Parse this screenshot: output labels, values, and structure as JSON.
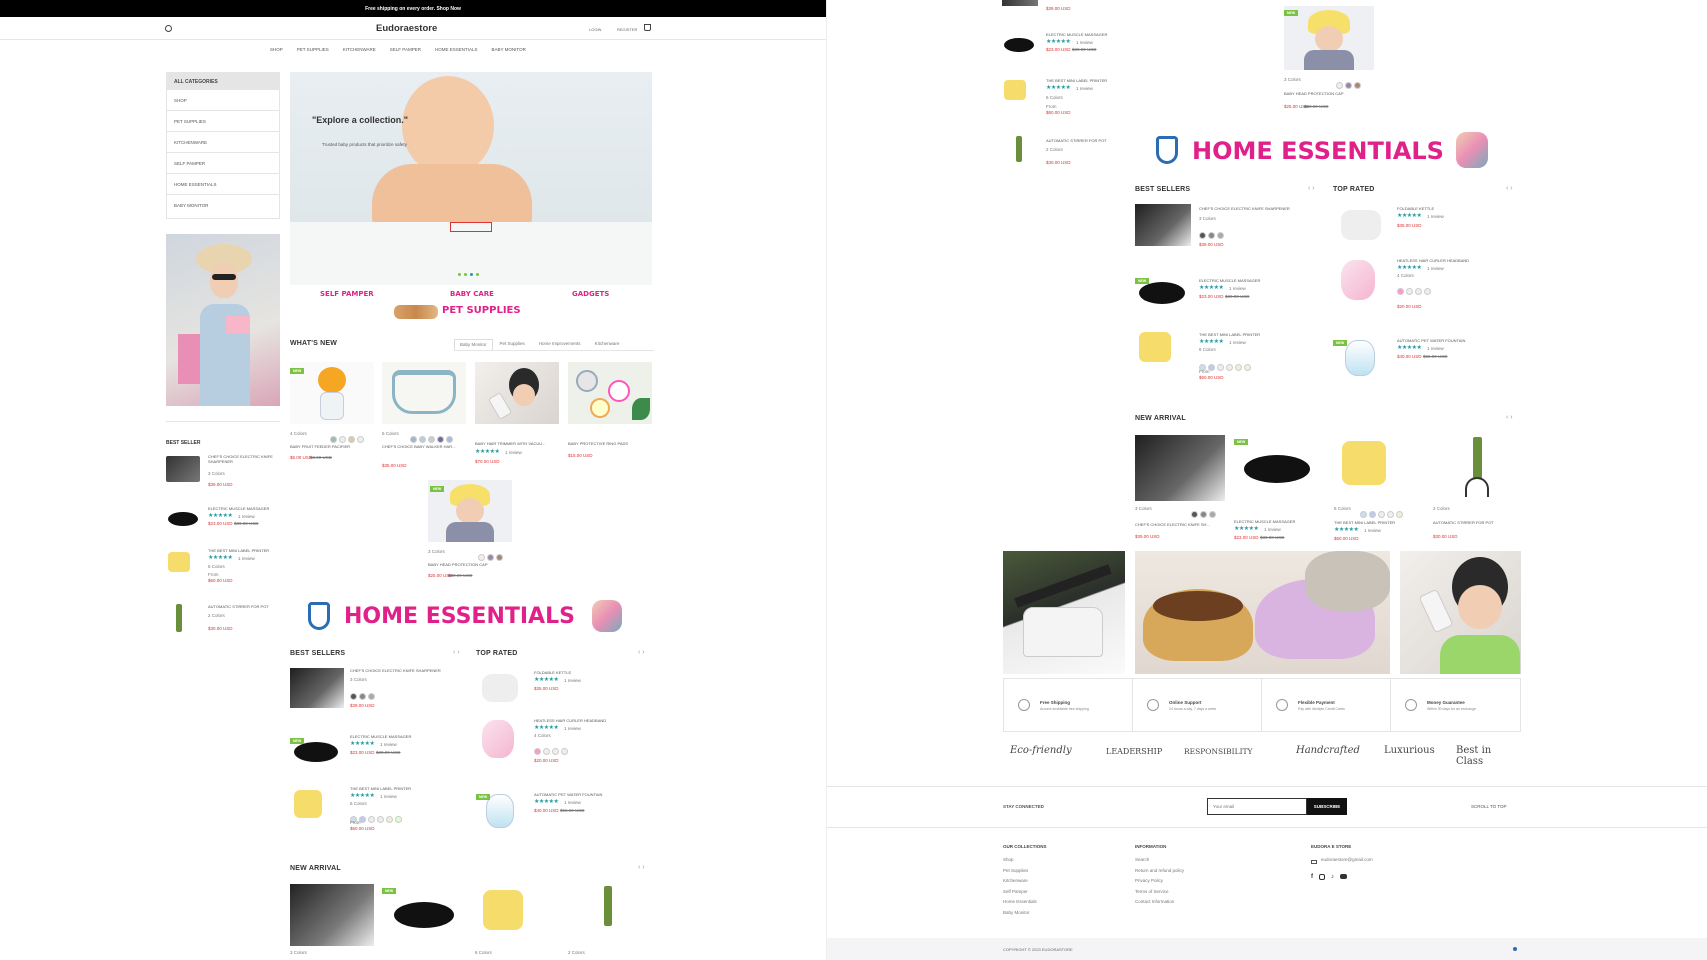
{
  "promo_bar": {
    "text": "Free shipping on every order. Shop Now"
  },
  "header": {
    "logo": "Eudoraestore",
    "login": "LOGIN",
    "register": "REGISTER"
  },
  "nav": [
    "SHOP",
    "PET SUPPLIES",
    "KITCHENWARE",
    "SELF PAMPER",
    "HOME ESSENTIALS",
    "BABY MONITOR"
  ],
  "sidebar": {
    "title": "ALL CATEGORIES",
    "items": [
      "SHOP",
      "PET SUPPLIES",
      "KITCHENWARE",
      "SELF PAMPER",
      "HOME ESSENTIALS",
      "BABY MONITOR"
    ]
  },
  "hero": {
    "headline": "\"Explore a collection.\"",
    "subtitle": "Trusted baby products that prioritize safety"
  },
  "category_banners": {
    "self_pamper": "SELF PAMPER",
    "baby_care": "BABY CARE",
    "gadgets": "GADGETS",
    "pet_supplies": "PET SUPPLIES"
  },
  "best_seller_side": {
    "title": "BEST SELLER",
    "items": [
      {
        "name": "CHEF'S CHOICE ELECTRIC KNIFE SHARPENER",
        "colors": "3 Colors",
        "price": "$39.00 USD"
      },
      {
        "name": "ELECTRIC MUSCLE MASSAGER",
        "reviews": "1 review",
        "price": "$23.00 USD",
        "old": "$30.00 USD"
      },
      {
        "name": "THE BEST MINI LABEL PRINTER",
        "reviews": "1 review",
        "colors": "6 Colors",
        "from": "From",
        "price": "$60.00 USD"
      },
      {
        "name": "AUTOMATIC STIRRER FOR POT",
        "colors": "2 Colors",
        "price": "$30.00 USD"
      }
    ]
  },
  "whats_new": {
    "title": "WHAT'S NEW",
    "tabs": [
      "Baby Monitor",
      "Pet Supplies",
      "Home Improvements",
      "Kitchenware"
    ],
    "products": [
      {
        "name": "BABY FRUIT FEEDER PACIFIER",
        "colors": "4 Colors",
        "price": "$5.00 USD",
        "old": "$8.00 USD"
      },
      {
        "name": "CHEF'S CHOICE BABY WALKER HAR...",
        "colors": "5 Colors",
        "price": "$35.00 USD"
      },
      {
        "name": "BABY HAIR TRIMMER WITH VACUU...",
        "reviews": "1 review",
        "price": "$70.00 USD"
      },
      {
        "name": "BABY PROTECTIVE RING PADS",
        "price": "$15.00 USD"
      },
      {
        "name": "BABY HEAD PROTECTION CAP",
        "colors": "3 Colors",
        "price": "$25.00 USD",
        "old": "$30.00 USD"
      }
    ]
  },
  "home_essentials": {
    "banner": "HOME ESSENTIALS",
    "best_sellers": {
      "title": "BEST SELLERS",
      "items": [
        {
          "name": "CHEF'S CHOICE ELECTRIC KNIFE SHARPENER",
          "colors": "3 Colors",
          "price": "$39.00 USD"
        },
        {
          "name": "ELECTRIC MUSCLE MASSAGER",
          "reviews": "1 review",
          "price": "$23.00 USD",
          "old": "$30.00 USD"
        },
        {
          "name": "THE BEST MINI LABEL PRINTER",
          "reviews": "1 review",
          "colors": "6 Colors",
          "from": "From",
          "price": "$60.00 USD"
        }
      ]
    },
    "top_rated": {
      "title": "TOP RATED",
      "items": [
        {
          "name": "FOLDABLE KETTLE",
          "reviews": "1 review",
          "price": "$35.00 USD"
        },
        {
          "name": "HEATLESS HAIR CURLER HEADBAND",
          "reviews": "1 review",
          "colors": "4 Colors",
          "price": "$20.00 USD"
        },
        {
          "name": "AUTOMATIC PET WATER FOUNTAIN",
          "reviews": "1 review",
          "price": "$40.00 USD",
          "old": "$55.00 USD"
        }
      ]
    }
  },
  "new_arrival": {
    "title": "NEW ARRIVAL",
    "products": [
      {
        "name": "CHEF'S CHOICE ELECTRIC KNIFE SH...",
        "colors": "3 Colors",
        "price": "$39.00 USD"
      },
      {
        "name": "ELECTRIC MUSCLE MASSAGER",
        "reviews": "1 review",
        "price": "$23.00 USD",
        "old": "$30.00 USD"
      },
      {
        "name": "THE BEST MINI LABEL PRINTER",
        "reviews": "1 review",
        "colors": "6 Colors",
        "price": "$60.00 USD"
      },
      {
        "name": "AUTOMATIC STIRRER FOR POT",
        "colors": "2 Colors",
        "price": "$30.00 USD"
      }
    ]
  },
  "features": [
    {
      "title": "Free Shipping",
      "sub": "Around worldwide free shipping"
    },
    {
      "title": "Online Support",
      "sub": "24 hours a day, 7 days a week"
    },
    {
      "title": "Flexible Payment",
      "sub": "Pay with Multiple Credit Cards"
    },
    {
      "title": "Money Guarantee",
      "sub": "Within 30 days for an exchange"
    }
  ],
  "brands": [
    "Eco-friendly",
    "LEADERSHIP",
    "RESPONSIBILITY",
    "Handcrafted",
    "Luxurious",
    "Best in Class"
  ],
  "newsletter": {
    "label": "STAY CONNECTED",
    "placeholder": "Your email",
    "button": "SUBSCRIBE",
    "scroll_top": "SCROLL TO TOP"
  },
  "footer": {
    "collections": {
      "title": "OUR COLLECTIONS",
      "links": [
        "Shop",
        "Pet Supplies",
        "Kitchenware",
        "Self Pamper",
        "Home Essentials",
        "Baby Monitor"
      ]
    },
    "information": {
      "title": "INFORMATION",
      "links": [
        "Search",
        "Return and refund policy",
        "Privacy Policy",
        "Terms of Service",
        "Contact Information"
      ]
    },
    "store": {
      "title": "EUDORA E STORE",
      "email": "eudoraestore@gmail.com"
    },
    "copyright": "COPYRIGHT © 2023 EUDORASTORE"
  }
}
